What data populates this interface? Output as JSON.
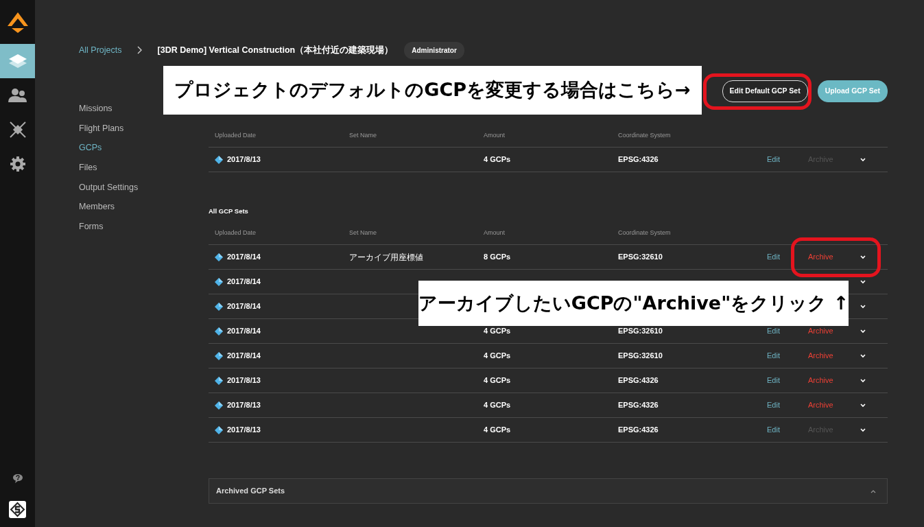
{
  "rail": [
    {
      "kind": "layers",
      "selected": true
    },
    {
      "kind": "people",
      "selected": false
    },
    {
      "kind": "drone",
      "selected": false
    },
    {
      "kind": "gear",
      "selected": false
    }
  ],
  "breadcrumb": {
    "root": "All Projects",
    "current": "[3DR Demo] Vertical Construction（本社付近の建築現場）",
    "role": "Administrator"
  },
  "nav": [
    {
      "label": "Missions",
      "selected": false
    },
    {
      "label": "Flight Plans",
      "selected": false
    },
    {
      "label": "GCPs",
      "selected": true
    },
    {
      "label": "Files",
      "selected": false
    },
    {
      "label": "Output Settings",
      "selected": false
    },
    {
      "label": "Members",
      "selected": false
    },
    {
      "label": "Forms",
      "selected": false
    }
  ],
  "buttons": [
    {
      "label": "Edit Default GCP Set",
      "kind": "outline"
    },
    {
      "label": "Upload GCP Set",
      "kind": "primary"
    }
  ],
  "sections": [
    {
      "columns": [
        "Uploaded Date",
        "Set Name",
        "Amount",
        "Coordinate System"
      ],
      "rows": [
        {
          "date": "2017/8/13",
          "amount": "4 GCPs",
          "system": "EPSG:4326",
          "edit": "Edit",
          "archive": "Archive",
          "disabled": true
        }
      ]
    },
    {
      "title": "All GCP Sets",
      "columns": [
        "Uploaded Date",
        "Set Name",
        "Amount",
        "Coordinate System"
      ],
      "rows": [
        {
          "date": "2017/8/14",
          "name": "アーカイブ用座標値",
          "amount": "8 GCPs",
          "system": "EPSG:32610",
          "edit": "Edit",
          "archive": "Archive",
          "disabled": false
        },
        {
          "date": "2017/8/14"
        },
        {
          "date": "2017/8/14"
        },
        {
          "date": "2017/8/14",
          "amount": "4 GCPs",
          "system": "EPSG:32610",
          "edit": "Edit",
          "archive": "Archive",
          "disabled": false
        },
        {
          "date": "2017/8/14",
          "amount": "4 GCPs",
          "system": "EPSG:32610",
          "edit": "Edit",
          "archive": "Archive",
          "disabled": false
        },
        {
          "date": "2017/8/13",
          "amount": "4 GCPs",
          "system": "EPSG:4326",
          "edit": "Edit",
          "archive": "Archive",
          "disabled": false
        },
        {
          "date": "2017/8/13",
          "amount": "4 GCPs",
          "system": "EPSG:4326",
          "edit": "Edit",
          "archive": "Archive",
          "disabled": false
        },
        {
          "date": "2017/8/13",
          "amount": "4 GCPs",
          "system": "EPSG:4326",
          "edit": "Edit",
          "archive": "Archive",
          "disabled": true
        }
      ]
    }
  ],
  "archived": {
    "title": "Archived GCP Sets",
    "expanded": false
  },
  "annotations": [
    {
      "kind": "callout",
      "text": "プロジェクトのデフォルトのGCPを変更する場合はこちら→"
    },
    {
      "kind": "callout",
      "text": "アーカイブしたいGCPの\"Archive\"をクリック ↑"
    },
    {
      "kind": "highlight"
    },
    {
      "kind": "highlight"
    }
  ]
}
